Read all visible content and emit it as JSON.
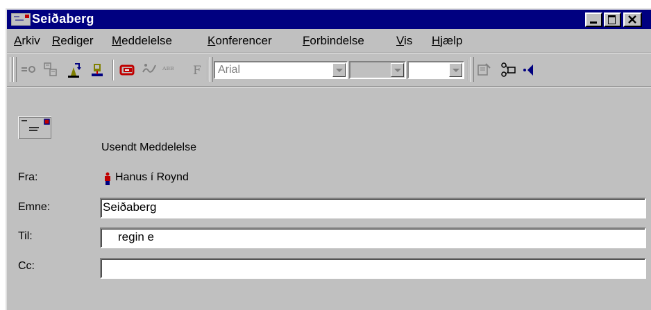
{
  "window": {
    "title": "Seiðaberg",
    "controls": [
      "minimize",
      "maximize",
      "close"
    ]
  },
  "menu": {
    "items": [
      {
        "key": "A",
        "rest": "rkiv"
      },
      {
        "key": "R",
        "rest": "ediger"
      },
      {
        "key": "M",
        "rest": "eddelelse"
      },
      {
        "key": "K",
        "rest": "onferencer"
      },
      {
        "key": "F",
        "rest": "orbindelse"
      },
      {
        "key": "V",
        "rest": "is"
      },
      {
        "key": "H",
        "rest": "jælp"
      }
    ]
  },
  "toolbar": {
    "font_name": "Arial",
    "font_size": "",
    "font_color": "",
    "icons": [
      "send-icon",
      "address-book-icon",
      "check-names-icon",
      "sender-icon",
      "attach-icon",
      "spell-check-icon",
      "text-style-icon",
      "font-icon",
      "properties-icon",
      "routing-icon",
      "reply-icon"
    ]
  },
  "header": {
    "status": "Usendt Meddelelse",
    "from_label": "Fra:",
    "from_value": "Hanus í Roynd",
    "subject_label": "Emne:",
    "subject_value": "Seiðaberg",
    "to_label": "Til:",
    "to_value": "regin e",
    "cc_label": "Cc:",
    "cc_value": ""
  }
}
